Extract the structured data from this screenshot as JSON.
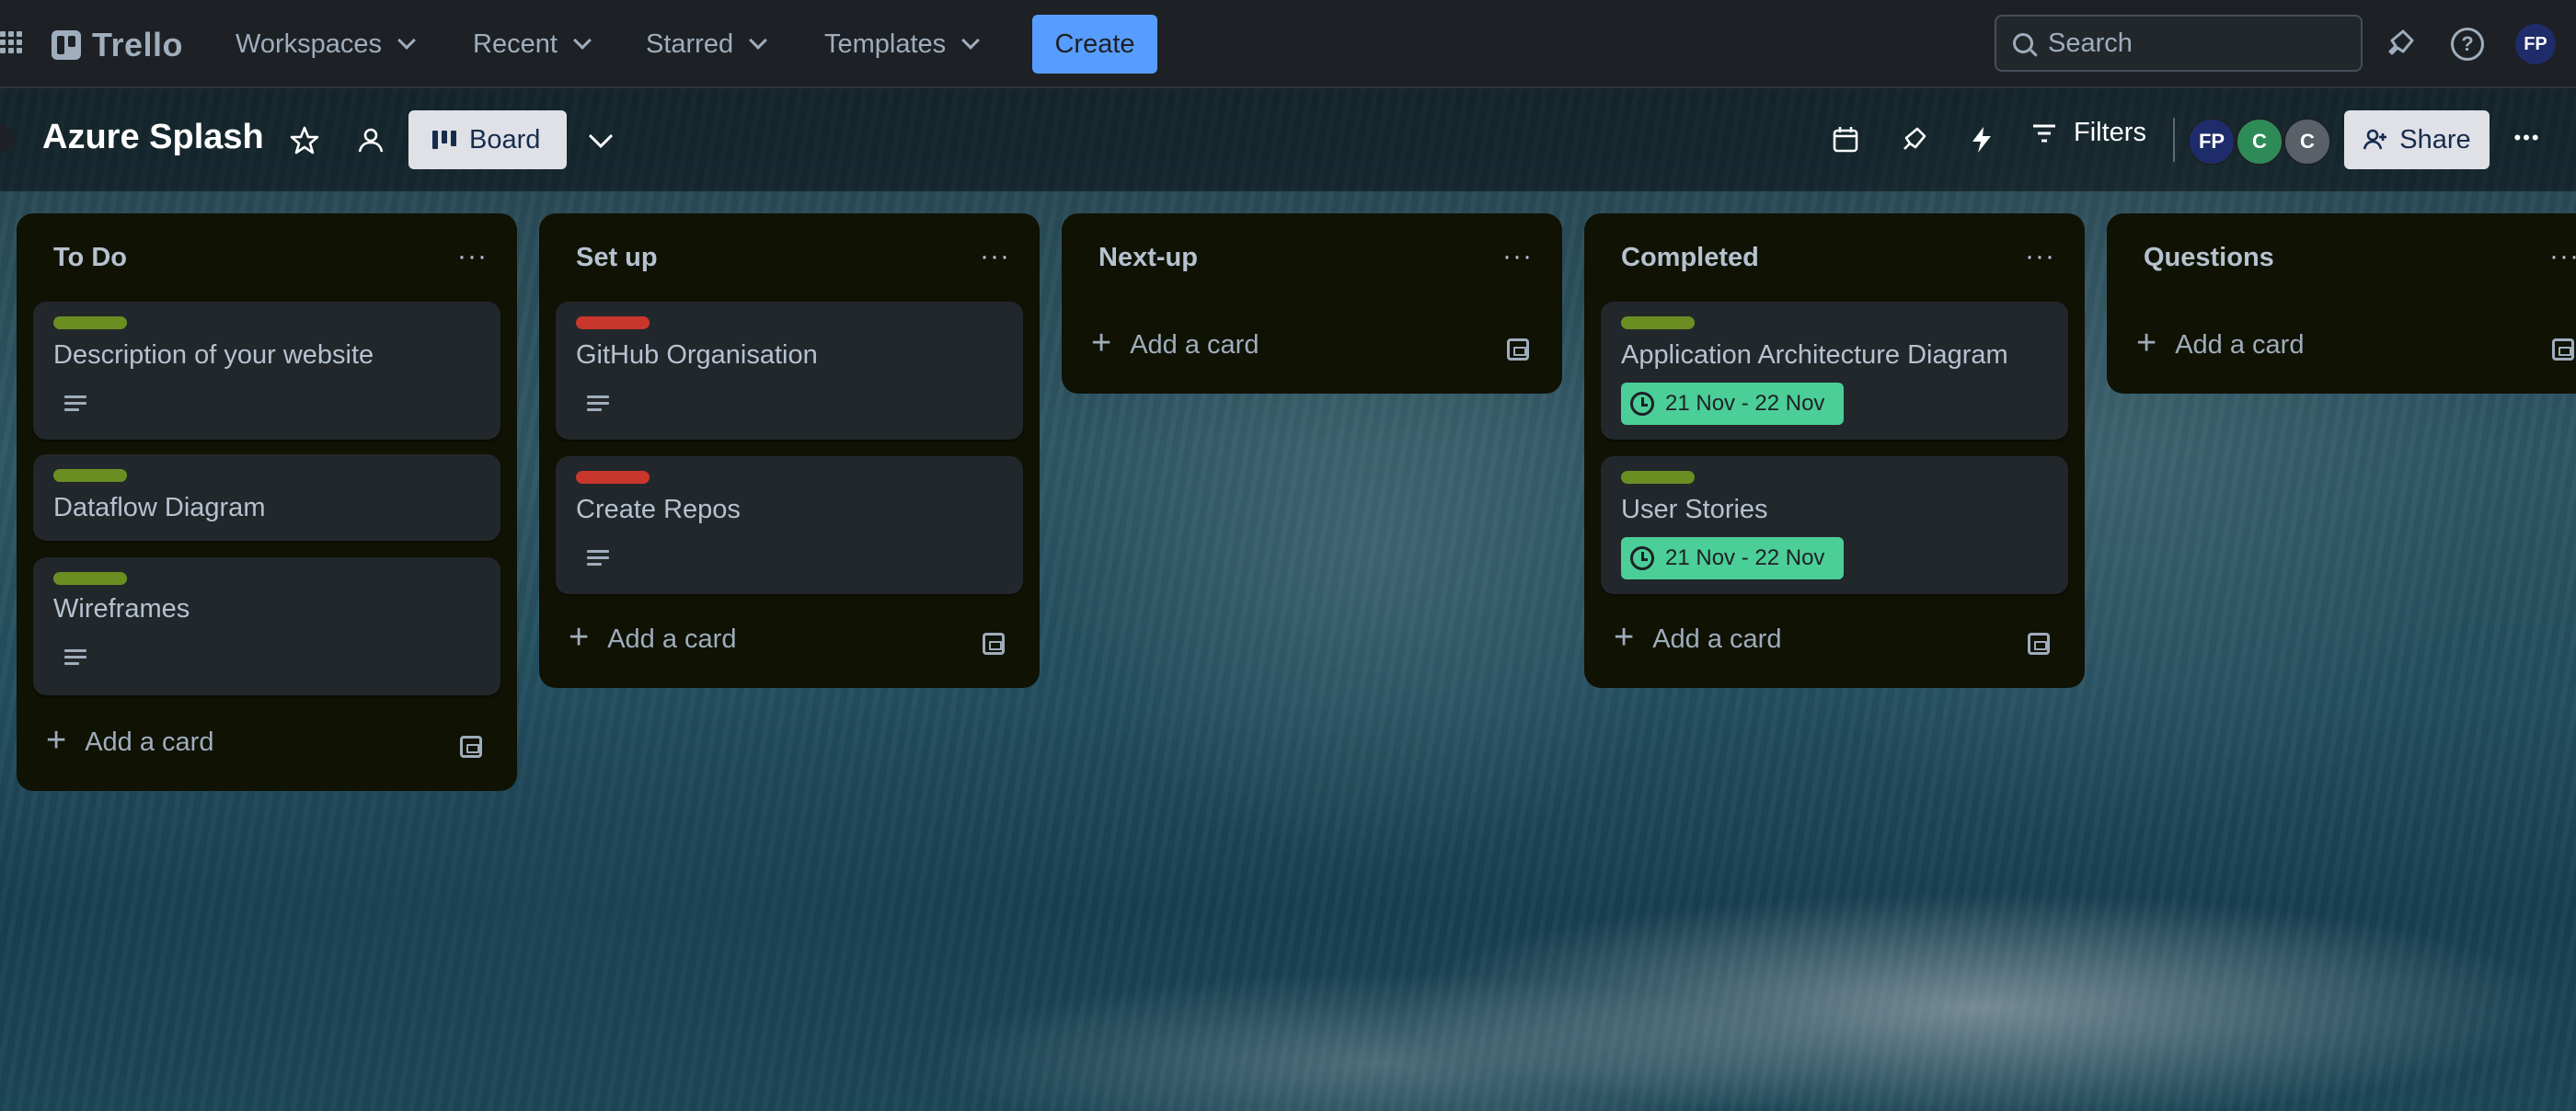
{
  "nav": {
    "logo": "Trello",
    "menus": [
      "Workspaces",
      "Recent",
      "Starred",
      "Templates"
    ],
    "create_label": "Create",
    "search_placeholder": "Search",
    "user_initials": "FP"
  },
  "board": {
    "title": "Azure Splash",
    "view_label": "Board",
    "filters_label": "Filters",
    "share_label": "Share",
    "members": [
      {
        "initials": "FP",
        "color": "#1f2c6b"
      },
      {
        "initials": "C",
        "color": "#2e8b57"
      },
      {
        "initials": "C",
        "color": "#5a6068"
      }
    ]
  },
  "colors": {
    "green_label": "#6b8e23",
    "red_label": "#c9372c",
    "date_badge": "#4bce97",
    "accent": "#579dff"
  },
  "lists": [
    {
      "title": "To Do",
      "cards": [
        {
          "title": "Description of your website",
          "label": "green",
          "has_description": true
        },
        {
          "title": "Dataflow Diagram",
          "label": "green",
          "has_description": false
        },
        {
          "title": "Wireframes",
          "label": "green",
          "has_description": true
        }
      ],
      "add_label": "Add a card"
    },
    {
      "title": "Set up",
      "cards": [
        {
          "title": "GitHub Organisation",
          "label": "red",
          "has_description": true
        },
        {
          "title": "Create Repos",
          "label": "red",
          "has_description": true
        }
      ],
      "add_label": "Add a card"
    },
    {
      "title": "Next-up",
      "cards": [],
      "add_label": "Add a card"
    },
    {
      "title": "Completed",
      "cards": [
        {
          "title": "Application Architecture Diagram",
          "label": "green",
          "date": "21 Nov - 22 Nov"
        },
        {
          "title": "User Stories",
          "label": "green",
          "date": "21 Nov - 22 Nov"
        }
      ],
      "add_label": "Add a card"
    },
    {
      "title": "Questions",
      "cards": [],
      "add_label": "Add a card"
    }
  ],
  "icons": {
    "menu": "···",
    "star": "☆",
    "more": "•••"
  }
}
